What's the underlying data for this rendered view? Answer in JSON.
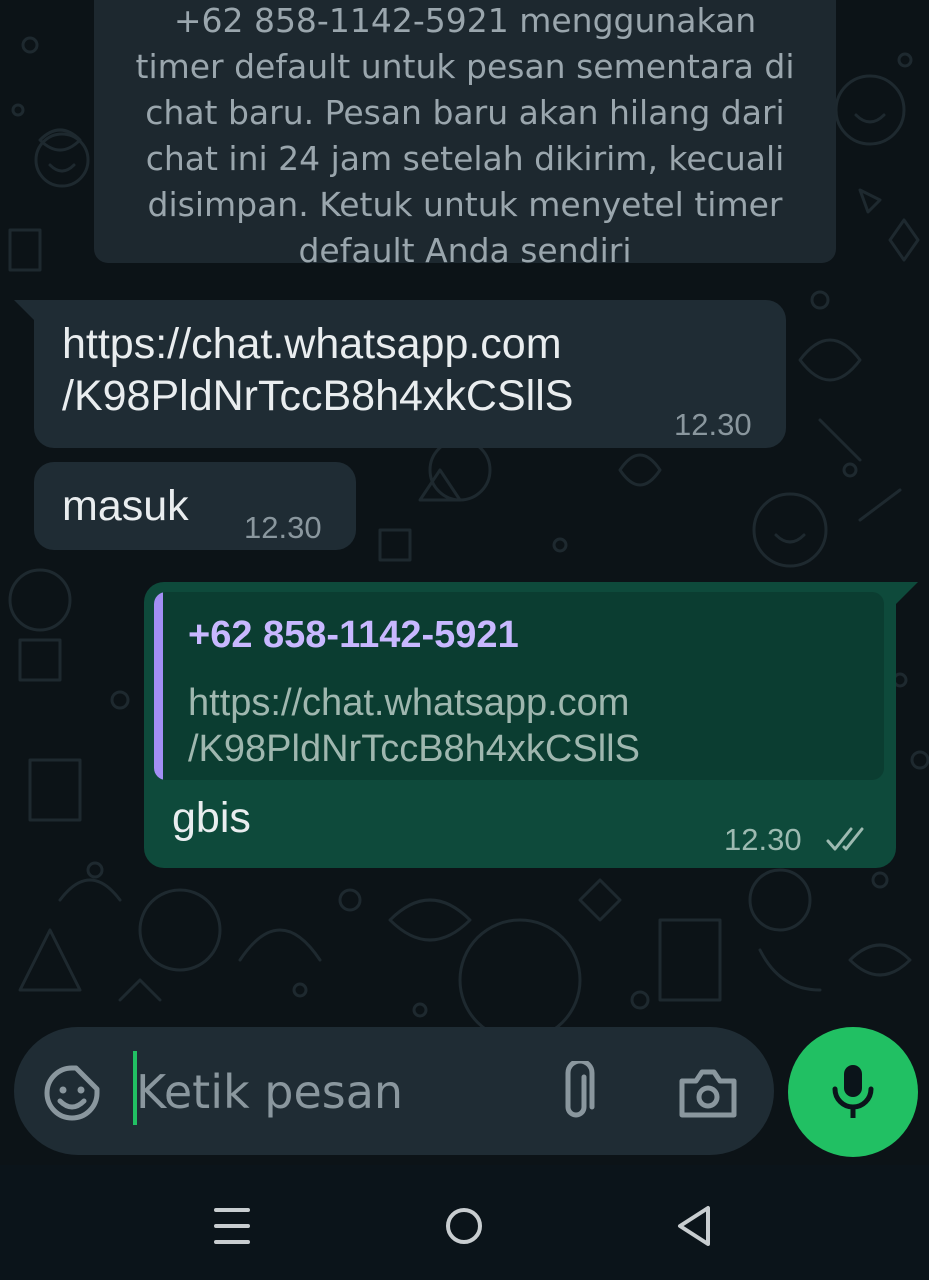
{
  "system_message": {
    "lines": [
      "+62 858-1142-5921 menggunakan",
      "timer default untuk pesan sementara di",
      "chat baru. Pesan baru akan hilang dari",
      "chat ini 24 jam setelah dikirim, kecuali",
      "disimpan. Ketuk untuk menyetel timer",
      "default Anda sendiri"
    ]
  },
  "messages": [
    {
      "direction": "incoming",
      "lines": [
        "https://chat.whatsapp.com",
        "/K98PldNrTccB8h4xkCSllS"
      ],
      "time": "12.30"
    },
    {
      "direction": "incoming",
      "text": "masuk",
      "time": "12.30"
    },
    {
      "direction": "outgoing",
      "quote": {
        "sender": "+62 858-1142-5921",
        "lines": [
          "https://chat.whatsapp.com",
          "/K98PldNrTccB8h4xkCSllS"
        ]
      },
      "text": "gbis",
      "time": "12.30",
      "status_icon": "double-check-icon"
    }
  ],
  "input": {
    "placeholder": "Ketik pesan",
    "value": ""
  },
  "icons": {
    "emoji": "sticker-emoji-icon",
    "attach": "paperclip-icon",
    "camera": "camera-icon",
    "mic": "microphone-icon",
    "nav_recent": "recent-apps-icon",
    "nav_home": "home-icon",
    "nav_back": "back-icon"
  },
  "colors": {
    "background": "#0b141a",
    "incoming_bubble": "#1f2c34",
    "outgoing_bubble": "#0e4a3b",
    "accent_green": "#21c063",
    "quote_bar": "#a28ff5",
    "quote_sender": "#c8b8ff"
  }
}
